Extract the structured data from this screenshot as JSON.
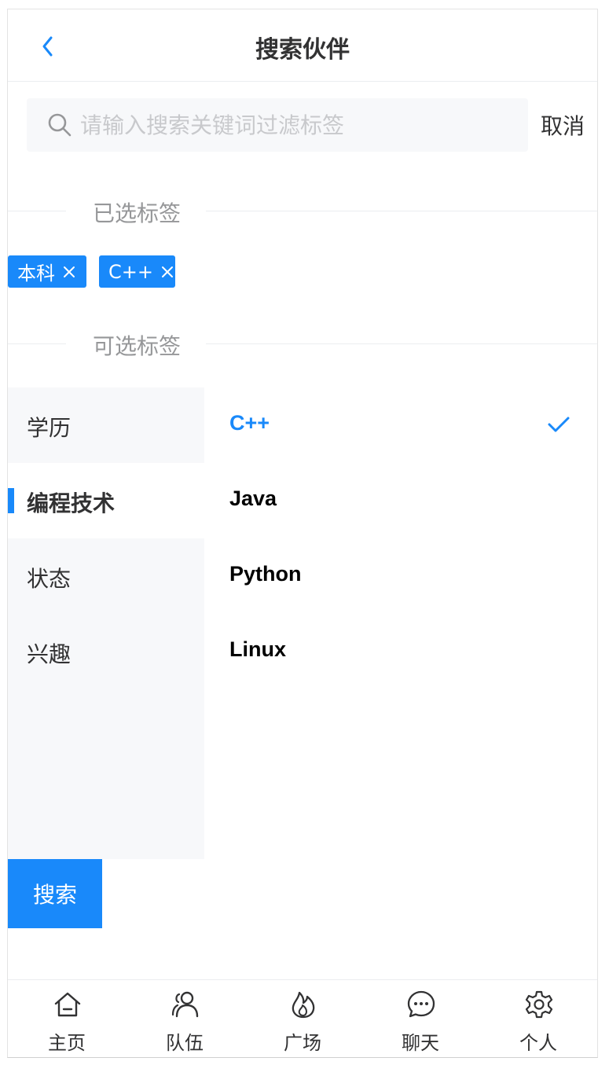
{
  "navbar": {
    "title": "搜索伙伴",
    "back_icon": "chevron-left-icon"
  },
  "search": {
    "placeholder": "请输入搜索关键词过滤标签",
    "value": "",
    "cancel_label": "取消"
  },
  "selected_section": {
    "title": "已选标签"
  },
  "selected_tags": [
    {
      "label": "本科"
    },
    {
      "label": "C++"
    }
  ],
  "available_section": {
    "title": "可选标签"
  },
  "categories": [
    {
      "label": "学历",
      "active": false
    },
    {
      "label": "编程技术",
      "active": true
    },
    {
      "label": "状态",
      "active": false
    },
    {
      "label": "兴趣",
      "active": false
    }
  ],
  "options": [
    {
      "label": "C++",
      "selected": true
    },
    {
      "label": "Java",
      "selected": false
    },
    {
      "label": "Python",
      "selected": false
    },
    {
      "label": "Linux",
      "selected": false
    }
  ],
  "submit_label": "搜索",
  "tabbar": [
    {
      "label": "主页",
      "icon": "home-icon"
    },
    {
      "label": "队伍",
      "icon": "team-icon"
    },
    {
      "label": "广场",
      "icon": "fire-icon"
    },
    {
      "label": "聊天",
      "icon": "chat-icon"
    },
    {
      "label": "个人",
      "icon": "settings-icon"
    }
  ],
  "colors": {
    "accent": "#1989fa",
    "panel_bg": "#f7f8fa",
    "muted_text": "#969799",
    "placeholder": "#c8c9cc"
  }
}
